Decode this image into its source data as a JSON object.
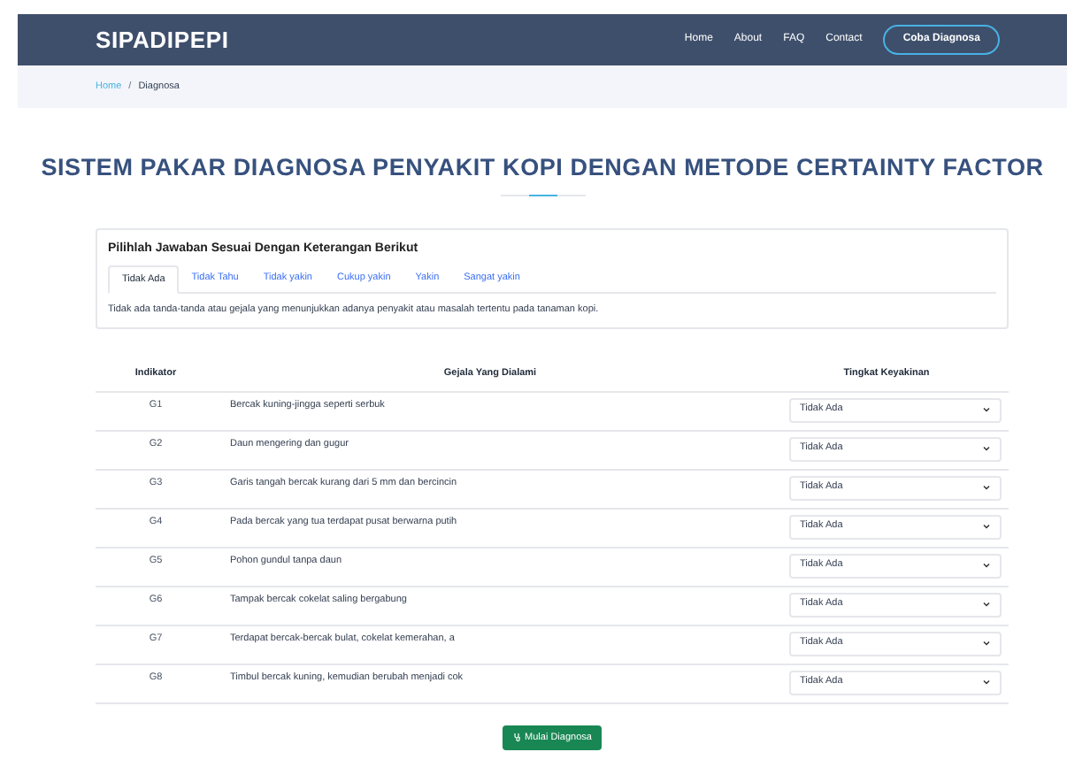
{
  "navbar": {
    "brand": "SIPADIPEPI",
    "links": [
      "Home",
      "About",
      "FAQ",
      "Contact"
    ],
    "cta": "Coba Diagnosa"
  },
  "breadcrumb": {
    "items": [
      "Home",
      "Diagnosa"
    ],
    "separator": "/"
  },
  "title": "SISTEM PAKAR DIAGNOSA PENYAKIT KOPI DENGAN METODE CERTAINTY FACTOR",
  "info_card": {
    "heading": "Pilihlah Jawaban Sesuai Dengan Keterangan Berikut",
    "tabs": [
      {
        "label": "Tidak Ada",
        "selected": true
      },
      {
        "label": "Tidak Tahu",
        "selected": false
      },
      {
        "label": "Tidak yakin",
        "selected": false
      },
      {
        "label": "Cukup yakin",
        "selected": false
      },
      {
        "label": "Yakin",
        "selected": false
      },
      {
        "label": "Sangat yakin",
        "selected": false
      }
    ],
    "description": "Tidak ada tanda-tanda atau gejala yang menunjukkan adanya penyakit atau masalah tertentu pada tanaman kopi."
  },
  "table": {
    "columns": [
      "Indikator",
      "Gejala Yang Dialami",
      "Tingkat Keyakinan"
    ],
    "rows": [
      {
        "code": "G1",
        "symptom": "Bercak kuning-jingga seperti serbuk",
        "answer": "Tidak Ada"
      },
      {
        "code": "G2",
        "symptom": "Daun mengering dan gugur",
        "answer": "Tidak Ada"
      },
      {
        "code": "G3",
        "symptom": "Garis tangah bercak kurang dari 5 mm dan bercincin",
        "answer": "Tidak Ada"
      },
      {
        "code": "G4",
        "symptom": "Pada bercak yang tua terdapat pusat berwarna putih",
        "answer": "Tidak Ada"
      },
      {
        "code": "G5",
        "symptom": "Pohon gundul tanpa daun",
        "answer": "Tidak Ada"
      },
      {
        "code": "G6",
        "symptom": "Tampak bercak cokelat saling bergabung",
        "answer": "Tidak Ada"
      },
      {
        "code": "G7",
        "symptom": "Terdapat bercak-bercak bulat, cokelat kemerahan, a",
        "answer": "Tidak Ada"
      },
      {
        "code": "G8",
        "symptom": "Timbul bercak kuning, kemudian berubah menjadi cok",
        "answer": "Tidak Ada"
      }
    ]
  },
  "submit_button": "Mulai Diagnosa"
}
